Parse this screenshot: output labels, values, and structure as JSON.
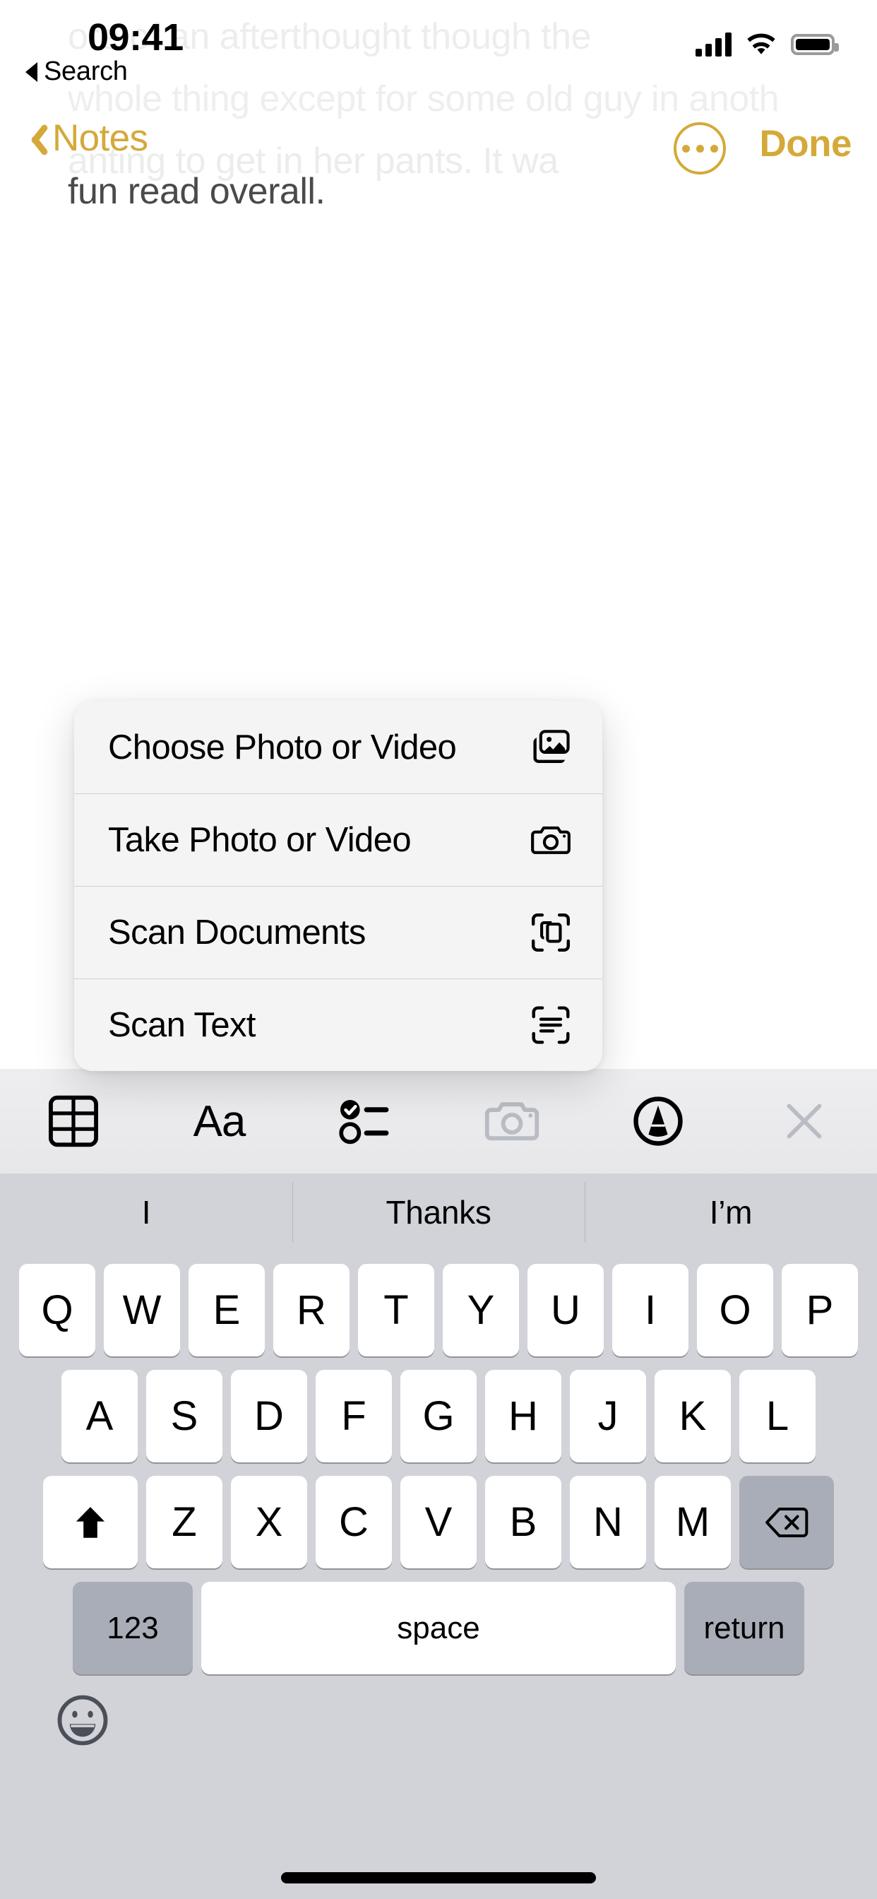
{
  "status_bar": {
    "time": "09:41",
    "cellular_icon": "cellular-bars-icon",
    "wifi_icon": "wifi-icon",
    "battery_icon": "battery-full-icon"
  },
  "back_to_app": {
    "label": "Search",
    "icon": "back-triangle-icon"
  },
  "nav_bar": {
    "back_label": "Notes",
    "back_icon": "chevron-left-icon",
    "more_icon": "ellipsis-circle-icon",
    "done_label": "Done",
    "accent_color": "#d5a939"
  },
  "note": {
    "ghost_lines": [
      "ore of an afterthought though the",
      "whole thing except for some old guy in anoth",
      "anting to get in her pants. It wa"
    ],
    "visible_line": "fun read overall."
  },
  "popup_menu": {
    "items": [
      {
        "label": "Choose Photo or Video",
        "icon": "photo-library-icon"
      },
      {
        "label": "Take Photo or Video",
        "icon": "camera-icon"
      },
      {
        "label": "Scan Documents",
        "icon": "document-scan-icon"
      },
      {
        "label": "Scan Text",
        "icon": "text-scan-icon"
      }
    ]
  },
  "format_toolbar": {
    "buttons": [
      {
        "name": "table-icon",
        "label": "Table",
        "enabled": true
      },
      {
        "name": "aa-format-icon",
        "label": "Aa",
        "enabled": true
      },
      {
        "name": "checklist-icon",
        "label": "Checklist",
        "enabled": true
      },
      {
        "name": "camera-icon",
        "label": "Camera",
        "enabled": false
      },
      {
        "name": "markup-pen-icon",
        "label": "Markup",
        "enabled": true
      },
      {
        "name": "close-icon",
        "label": "Close",
        "enabled": false
      }
    ]
  },
  "keyboard": {
    "predictions": [
      "I",
      "Thanks",
      "I’m"
    ],
    "row1": [
      "Q",
      "W",
      "E",
      "R",
      "T",
      "Y",
      "U",
      "I",
      "O",
      "P"
    ],
    "row2": [
      "A",
      "S",
      "D",
      "F",
      "G",
      "H",
      "J",
      "K",
      "L"
    ],
    "row3": [
      "Z",
      "X",
      "C",
      "V",
      "B",
      "N",
      "M"
    ],
    "shift_icon": "shift-arrow-icon",
    "delete_icon": "delete-backspace-icon",
    "numbers_label": "123",
    "space_label": "space",
    "return_label": "return",
    "emoji_icon": "emoji-smiley-icon"
  },
  "home_indicator": {
    "name": "home-indicator"
  }
}
